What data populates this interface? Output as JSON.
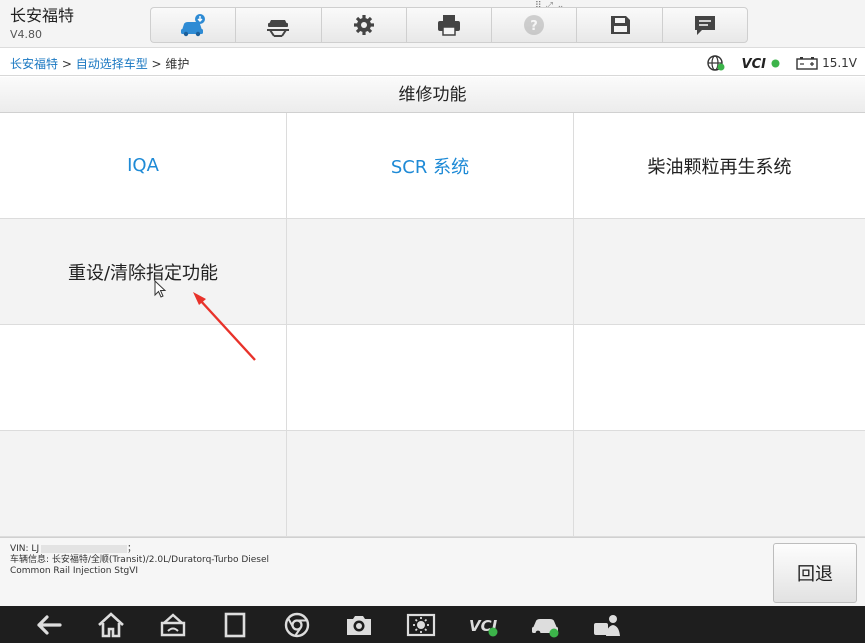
{
  "app": {
    "title": "长安福特",
    "version": "V4.80"
  },
  "toolbar": {
    "items": [
      {
        "name": "vehicle-diagnose",
        "icon": "car-cloud-icon"
      },
      {
        "name": "vehicle-lift",
        "icon": "car-lift-icon"
      },
      {
        "name": "settings",
        "icon": "gear-icon"
      },
      {
        "name": "print",
        "icon": "printer-icon"
      },
      {
        "name": "help",
        "icon": "help-icon"
      },
      {
        "name": "save",
        "icon": "save-icon"
      },
      {
        "name": "message",
        "icon": "message-icon"
      }
    ]
  },
  "breadcrumb": {
    "items": [
      "长安福特",
      "自动选择车型",
      "维护"
    ],
    "separator": " > "
  },
  "status": {
    "vci": "VCI",
    "voltage": "15.1V"
  },
  "section": {
    "title": "维修功能"
  },
  "functions": [
    {
      "label": "IQA",
      "color": "blue"
    },
    {
      "label": "SCR 系统",
      "color": "blue"
    },
    {
      "label": "柴油颗粒再生系统",
      "color": "dark"
    },
    {
      "label": "重设/清除指定功能",
      "color": "dark"
    },
    {
      "label": "",
      "color": "dark"
    },
    {
      "label": "",
      "color": "dark"
    },
    {
      "label": "",
      "color": "dark"
    },
    {
      "label": "",
      "color": "dark"
    },
    {
      "label": "",
      "color": "dark"
    },
    {
      "label": "",
      "color": "dark"
    },
    {
      "label": "",
      "color": "dark"
    },
    {
      "label": "",
      "color": "dark"
    }
  ],
  "footer": {
    "vin_label": "VIN: LJ",
    "vin_suffix": "；",
    "vehicle_info": "车辆信息: 长安福特/全顺(Transit)/2.0L/Duratorq-Turbo Diesel",
    "engine_info": "Common Rail Injection StgVI",
    "back_label": "回退"
  },
  "navbar": {
    "items": [
      "back-icon",
      "home-icon",
      "android-icon",
      "recent-apps-icon",
      "chrome-icon",
      "camera-icon",
      "brightness-icon",
      "vci-icon",
      "car-check-icon",
      "remote-expert-icon"
    ]
  },
  "colors": {
    "accent": "#1e8ad6",
    "link": "#1a78c2",
    "arrow": "#e8322a"
  }
}
